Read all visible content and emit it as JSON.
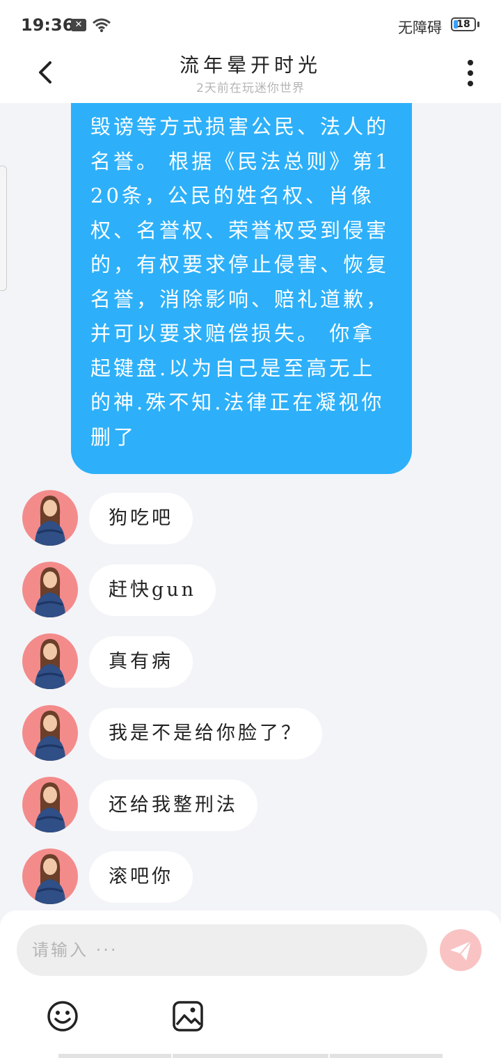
{
  "status": {
    "time": "19:36",
    "accessibility": "无障碍",
    "battery": "18"
  },
  "header": {
    "title": "流年晕开时光",
    "subtitle": "2天前在玩迷你世界"
  },
  "chat": {
    "sent_text": "毁谤等方式损害公民、法人的名誉。 根据《民法总则》第120条，公民的姓名权、肖像权、名誉权、荣誉权受到侵害的，有权要求停止侵害、恢复名誉，消除影响、赔礼道歉，并可以要求赔偿损失。 你拿起键盘.以为自己是至高无上的神.殊不知.法律正在凝视你删了",
    "received": [
      {
        "text": "狗吃吧"
      },
      {
        "text": " 赶快gun"
      },
      {
        "text": "真有病"
      },
      {
        "text": "我是不是给你脸了？"
      },
      {
        "text": "还给我整刑法"
      },
      {
        "text": "滚吧你"
      }
    ]
  },
  "input": {
    "placeholder": "请输入 ···"
  },
  "icons": {
    "back": "chevron-left-icon",
    "more": "more-vertical-icon",
    "send": "send-icon",
    "emoji": "emoji-icon",
    "image": "image-icon"
  },
  "colors": {
    "sent_bubble": "#2db0f9",
    "send_button": "#f9c3c3",
    "avatar_bg": "#f48b8b"
  }
}
